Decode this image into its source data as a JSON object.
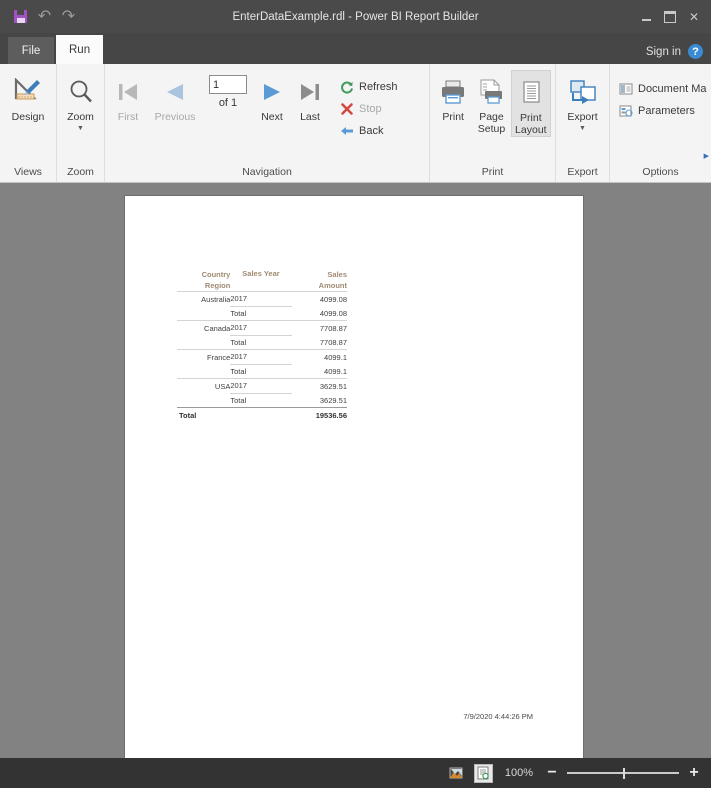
{
  "window": {
    "title": "EnterDataExample.rdl - Power BI Report Builder",
    "quick_access": {
      "save_label": "save-icon",
      "undo_label": "↶",
      "redo_label": "↷"
    },
    "controls": {
      "minimize": "−",
      "maximize": "▭",
      "close": "✕"
    }
  },
  "tabs": [
    {
      "label": "File",
      "active": false
    },
    {
      "label": "Run",
      "active": true
    }
  ],
  "account": {
    "signin_label": "Sign in",
    "help_label": "?"
  },
  "ribbon": {
    "groups": [
      {
        "title": "Views",
        "buttons": [
          {
            "label": "Design",
            "icon": "design-ruler-pencil-icon",
            "enabled": true
          }
        ]
      },
      {
        "title": "Zoom",
        "buttons": [
          {
            "label": "Zoom",
            "icon": "magnifier-icon",
            "enabled": true,
            "has_dropdown": true
          }
        ]
      },
      {
        "title": "Navigation",
        "buttons": [
          {
            "label": "First",
            "icon": "first-page-icon",
            "enabled": false
          },
          {
            "label": "Previous",
            "icon": "previous-page-icon",
            "enabled": false
          },
          {
            "label": "Next",
            "icon": "next-page-icon",
            "enabled": true
          },
          {
            "label": "Last",
            "icon": "last-page-icon",
            "enabled": true
          }
        ],
        "page_input": "1",
        "page_of": "of  1",
        "commands": [
          {
            "label": "Refresh",
            "icon": "refresh-icon",
            "enabled": true
          },
          {
            "label": "Stop",
            "icon": "stop-x-icon",
            "enabled": false
          },
          {
            "label": "Back",
            "icon": "back-arrow-icon",
            "enabled": true
          }
        ]
      },
      {
        "title": "Print",
        "buttons": [
          {
            "label": "Print",
            "icon": "printer-icon",
            "enabled": true
          },
          {
            "label": "Page Setup",
            "icon": "page-setup-icon",
            "enabled": true
          },
          {
            "label": "Print Layout",
            "icon": "print-layout-icon",
            "enabled": true,
            "selected": true
          }
        ]
      },
      {
        "title": "Export",
        "buttons": [
          {
            "label": "Export",
            "icon": "export-icon",
            "enabled": true,
            "has_dropdown": true
          }
        ]
      },
      {
        "title": "Options",
        "commands": [
          {
            "label": "Document Mа",
            "icon": "document-map-icon",
            "enabled": true
          },
          {
            "label": "Parameters",
            "icon": "parameters-icon",
            "enabled": true
          }
        ]
      }
    ]
  },
  "report": {
    "timestamp": "7/9/2020 4:44:26 PM",
    "table": {
      "headers": [
        "Country Region",
        "Sales Year",
        "Sales Amount"
      ],
      "header_lines": [
        [
          "Country",
          "Region"
        ],
        [
          "Sales Year",
          ""
        ],
        [
          "Sales",
          "Amount"
        ]
      ],
      "rows": [
        {
          "country": "Australia",
          "year": "2017",
          "amount": "4099.08",
          "kind": "detail"
        },
        {
          "country": "",
          "year": "Total",
          "amount": "4099.08",
          "kind": "sub"
        },
        {
          "country": "Canada",
          "year": "2017",
          "amount": "7708.87",
          "kind": "detail"
        },
        {
          "country": "",
          "year": "Total",
          "amount": "7708.87",
          "kind": "sub"
        },
        {
          "country": "France",
          "year": "2017",
          "amount": "4099.1",
          "kind": "detail"
        },
        {
          "country": "",
          "year": "Total",
          "amount": "4099.1",
          "kind": "sub"
        },
        {
          "country": "USA",
          "year": "2017",
          "amount": "3629.51",
          "kind": "detail"
        },
        {
          "country": "",
          "year": "Total",
          "amount": "3629.51",
          "kind": "sub"
        },
        {
          "country": "Total",
          "year": "",
          "amount": "19536.56",
          "kind": "grand"
        }
      ]
    }
  },
  "statusbar": {
    "zoom_level": "100%",
    "zoom_out": "−",
    "zoom_in": "+",
    "view_icons": [
      {
        "name": "normal-view-icon",
        "selected": false
      },
      {
        "name": "print-preview-view-icon",
        "selected": true
      }
    ]
  },
  "colors": {
    "titlebar": "#4a4a4a",
    "ribbon": "#f4f4f4",
    "accent_save": "#a451c4",
    "doc_background": "#828282",
    "statusbar": "#333333",
    "header_text": "#a08a72"
  }
}
